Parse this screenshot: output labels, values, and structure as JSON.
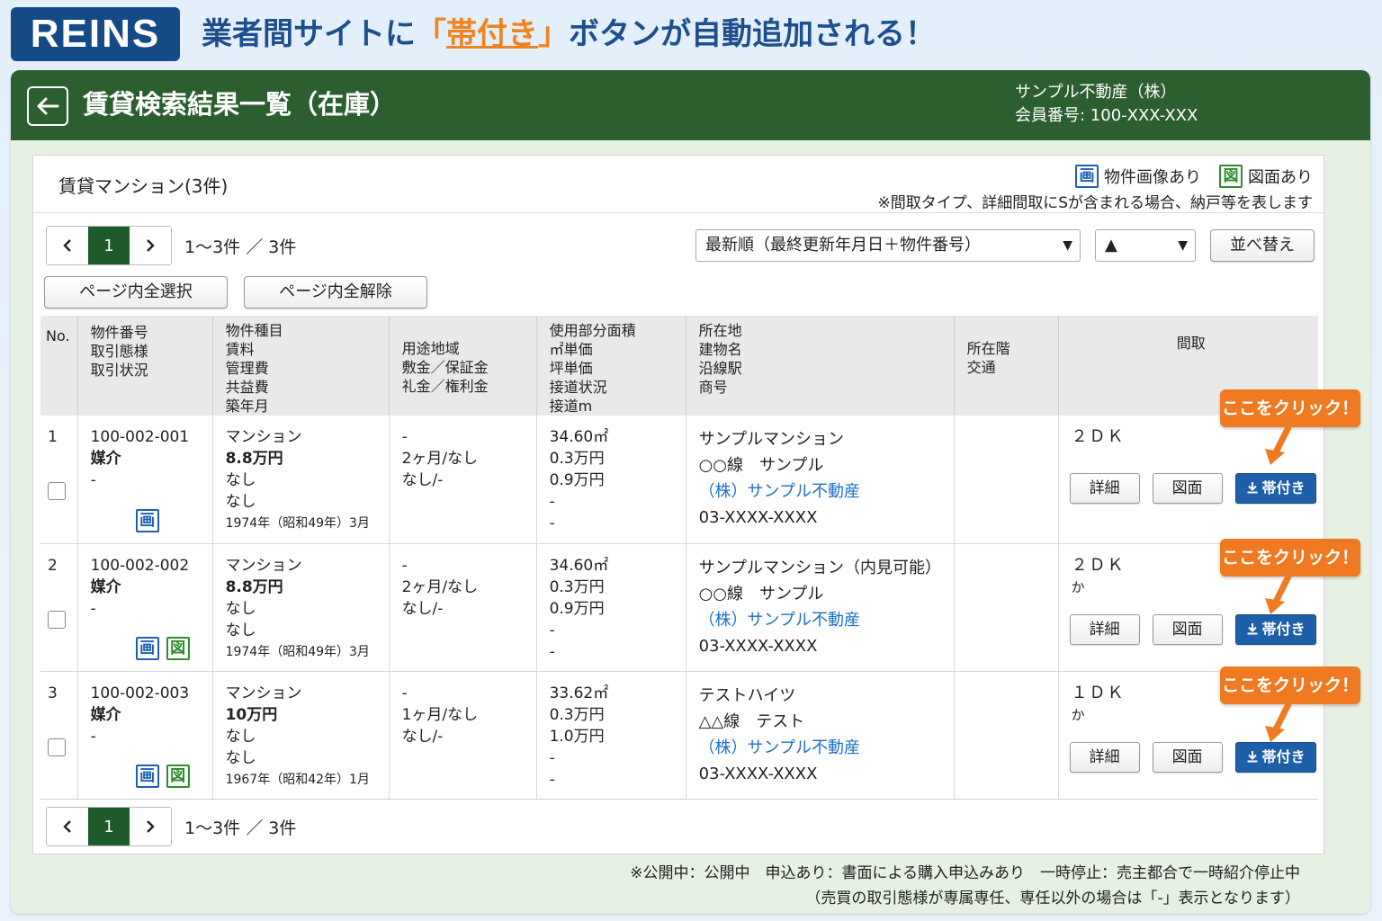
{
  "banner": {
    "logo": "REINS",
    "headline_pre": "業者間サイトに",
    "bracket_open": "「",
    "headline_highlight": "帯付き",
    "bracket_close": "」",
    "headline_post": "ボタンが自動追加される！"
  },
  "header": {
    "title": "賃貸検索結果一覧（在庫）",
    "company_name": "サンプル不動産（株）",
    "member_no": "会員番号: 100-XXX-XXX"
  },
  "panel": {
    "title": "賃貸マンション(3件)",
    "legend_image": "物件画像あり",
    "legend_plan": "図面あり",
    "legend_note": "※間取タイプ、詳細間取にSが含まれる場合、納戸等を表します"
  },
  "pager": {
    "current": "1",
    "range": "1〜3件 ／ 3件"
  },
  "sort": {
    "selected": "最新順（最終更新年月日＋物件番号）",
    "direction": "▲",
    "button": "並べ替え"
  },
  "actions": {
    "select_all": "ページ内全選択",
    "deselect_all": "ページ内全解除"
  },
  "icons": {
    "image_badge": "画",
    "plan_badge": "図",
    "back": "back-arrow-icon",
    "download": "download-icon"
  },
  "colors": {
    "header_green": "#2b5f2f",
    "page_current": "#1f5a2b",
    "obi_button": "#1d5fa8",
    "callout": "#f07a22",
    "link": "#1e6fc8"
  },
  "table": {
    "headers": {
      "no": "No.",
      "id": [
        "物件番号",
        "取引態様",
        "取引状況"
      ],
      "type": [
        "物件種目",
        "賃料",
        "管理費",
        "共益費",
        "築年月"
      ],
      "use": [
        "用途地域",
        "敷金／保証金",
        "礼金／権利金"
      ],
      "area": [
        "使用部分面積",
        "㎡単価",
        "坪単価",
        "接道状況",
        "接道m"
      ],
      "location": [
        "所在地",
        "建物名",
        "沿線駅",
        "商号"
      ],
      "floor": [
        "所在階",
        "交通"
      ],
      "layout": "間取"
    },
    "rows": [
      {
        "no": "1",
        "id": "100-002-001",
        "mode": "媒介",
        "status": "-",
        "type": "マンション",
        "rent": "8.8万円",
        "mgmt": "なし",
        "common": "なし",
        "built": "1974年（昭和49年）3月",
        "zone": "-",
        "deposit": "2ヶ月/なし",
        "key": "なし/-",
        "area": "34.60㎡",
        "sqm_price": "0.3万円",
        "tsubo_price": "0.9万円",
        "road": "-",
        "road_m": "-",
        "building": "サンプルマンション",
        "line": "○○線　サンプル",
        "trade_name": "（株）サンプル不動産",
        "phone": "03-XXXX-XXXX",
        "layout": "２ＤＫ",
        "layout_sub": "",
        "has_image": true,
        "has_plan": false
      },
      {
        "no": "2",
        "id": "100-002-002",
        "mode": "媒介",
        "status": "-",
        "type": "マンション",
        "rent": "8.8万円",
        "mgmt": "なし",
        "common": "なし",
        "built": "1974年（昭和49年）3月",
        "zone": "-",
        "deposit": "2ヶ月/なし",
        "key": "なし/-",
        "area": "34.60㎡",
        "sqm_price": "0.3万円",
        "tsubo_price": "0.9万円",
        "road": "-",
        "road_m": "-",
        "building": "サンプルマンション（内見可能）",
        "line": "○○線　サンプル",
        "trade_name": "（株）サンプル不動産",
        "phone": "03-XXXX-XXXX",
        "layout": "２ＤＫ",
        "layout_sub": "か",
        "has_image": true,
        "has_plan": true
      },
      {
        "no": "3",
        "id": "100-002-003",
        "mode": "媒介",
        "status": "-",
        "type": "マンション",
        "rent": "10万円",
        "mgmt": "なし",
        "common": "なし",
        "built": "1967年（昭和42年）1月",
        "zone": "-",
        "deposit": "1ヶ月/なし",
        "key": "なし/-",
        "area": "33.62㎡",
        "sqm_price": "0.3万円",
        "tsubo_price": "1.0万円",
        "road": "-",
        "road_m": "-",
        "building": "テストハイツ",
        "line": "△△線　テスト",
        "trade_name": "（株）サンプル不動産",
        "phone": "03-XXXX-XXXX",
        "layout": "１ＤＫ",
        "layout_sub": "か",
        "has_image": true,
        "has_plan": true
      }
    ],
    "row_buttons": {
      "detail": "詳細",
      "plan": "図面",
      "obi": "帯付き"
    },
    "callout": "ここをクリック！"
  },
  "footnotes": {
    "line1": "※公開中：公開中　申込あり：書面による購入申込みあり　一時停止：売主都合で一時紹介停止中",
    "line2": "（売買の取引態様が専属専任、専任以外の場合は「-」表示となります）"
  }
}
